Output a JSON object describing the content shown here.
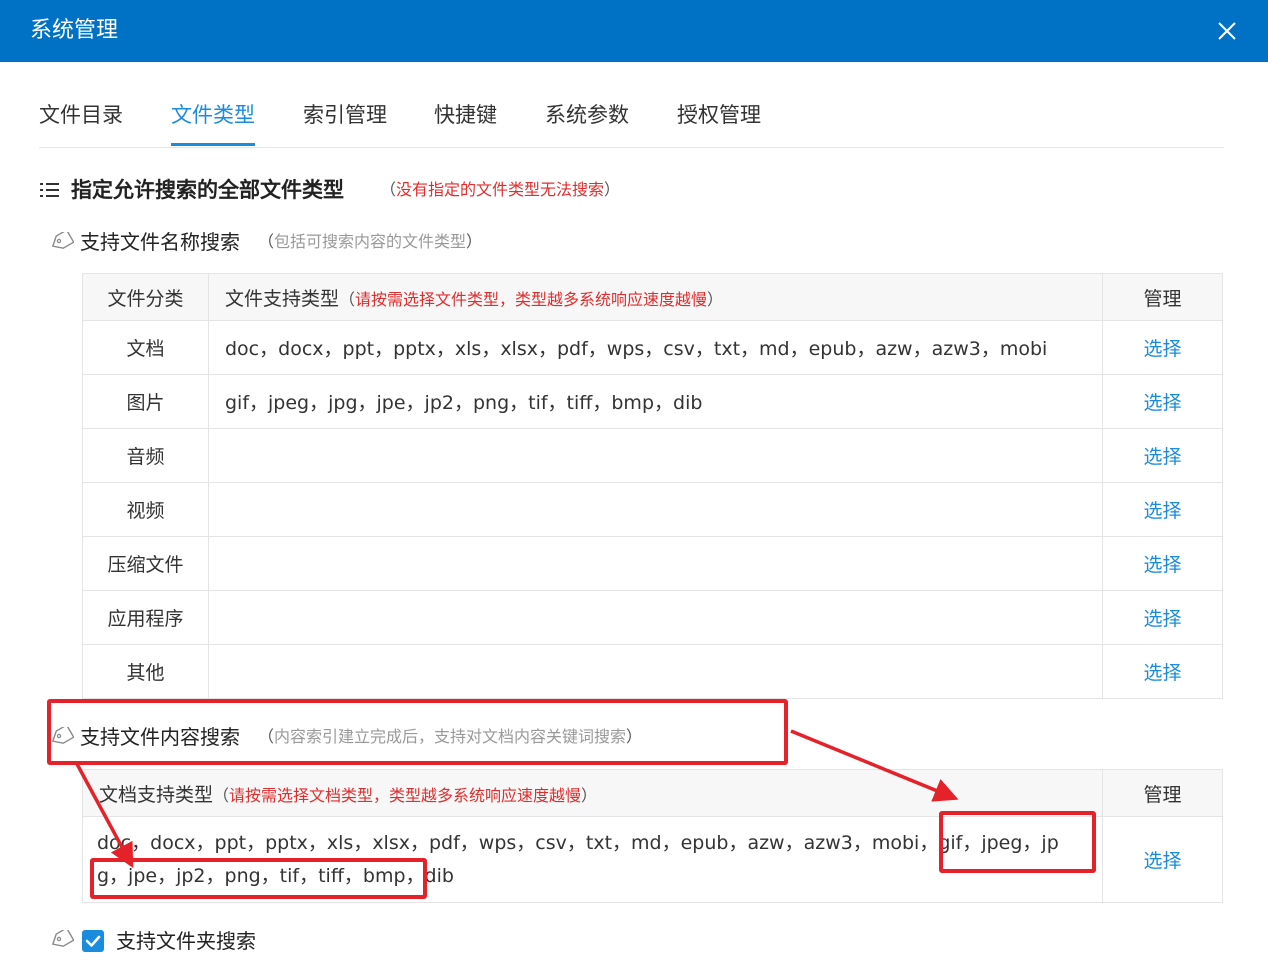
{
  "window": {
    "title": "系统管理"
  },
  "tabs": [
    {
      "label": "文件目录",
      "active": false
    },
    {
      "label": "文件类型",
      "active": true
    },
    {
      "label": "索引管理",
      "active": false
    },
    {
      "label": "快捷键",
      "active": false
    },
    {
      "label": "系统参数",
      "active": false
    },
    {
      "label": "授权管理",
      "active": false
    }
  ],
  "section": {
    "title": "指定允许搜索的全部文件类型",
    "note_open": "（",
    "note": "没有指定的文件类型无法搜索",
    "note_close": "）"
  },
  "name_search": {
    "title": "支持文件名称搜索",
    "note_open": "（",
    "note": "包括可搜索内容的文件类型",
    "note_close": "）",
    "table": {
      "col_category": "文件分类",
      "col_types": "文件支持类型",
      "col_types_note_open": "（",
      "col_types_note": "请按需选择文件类型，类型越多系统响应速度越慢",
      "col_types_note_close": "）",
      "col_manage": "管理",
      "rows": [
        {
          "category": "文档",
          "types": "doc，docx，ppt，pptx，xls，xlsx，pdf，wps，csv，txt，md，epub，azw，azw3，mobi",
          "action": "选择"
        },
        {
          "category": "图片",
          "types": "gif，jpeg，jpg，jpe，jp2，png，tif，tiff，bmp，dib",
          "action": "选择"
        },
        {
          "category": "音频",
          "types": "",
          "action": "选择"
        },
        {
          "category": "视频",
          "types": "",
          "action": "选择"
        },
        {
          "category": "压缩文件",
          "types": "",
          "action": "选择"
        },
        {
          "category": "应用程序",
          "types": "",
          "action": "选择"
        },
        {
          "category": "其他",
          "types": "",
          "action": "选择"
        }
      ]
    }
  },
  "content_search": {
    "title": "支持文件内容搜索",
    "note_open": "（",
    "note": "内容索引建立完成后，支持对文档内容关键词搜索",
    "note_close": "）",
    "table": {
      "col_types": "文档支持类型",
      "col_types_note_open": "（",
      "col_types_note": "请按需选择文档类型，类型越多系统响应速度越慢",
      "col_types_note_close": "）",
      "col_manage": "管理",
      "types": "doc，docx，ppt，pptx，xls，xlsx，pdf，wps，csv，txt，md，epub，azw，azw3，mobi，gif，jpeg，jpg，jpe，jp2，png，tif，tiff，bmp，dib",
      "action": "选择"
    }
  },
  "folder_search": {
    "label": "支持文件夹搜索",
    "checked": true
  },
  "colors": {
    "titlebar": "#0072c6",
    "accent": "#1a8cde",
    "warning": "#e02d2d",
    "annotation": "#e52229"
  },
  "icons": [
    "close-icon",
    "list-icon",
    "tag-icon",
    "checkmark-icon"
  ]
}
